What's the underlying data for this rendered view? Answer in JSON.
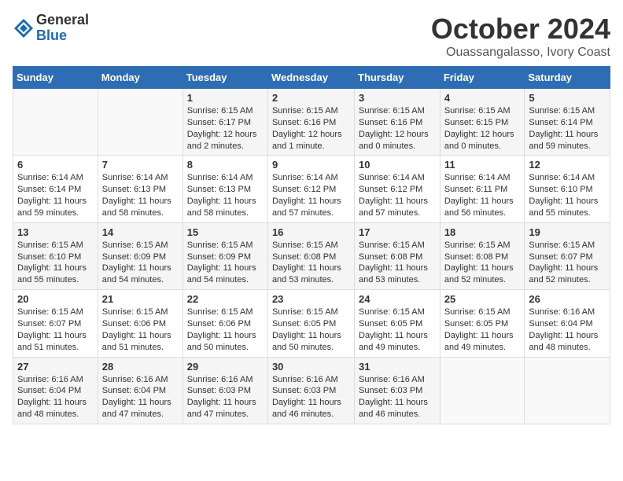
{
  "header": {
    "logo_general": "General",
    "logo_blue": "Blue",
    "month_title": "October 2024",
    "location": "Ouassangalasso, Ivory Coast"
  },
  "weekdays": [
    "Sunday",
    "Monday",
    "Tuesday",
    "Wednesday",
    "Thursday",
    "Friday",
    "Saturday"
  ],
  "weeks": [
    [
      {
        "day": "",
        "text": ""
      },
      {
        "day": "",
        "text": ""
      },
      {
        "day": "1",
        "text": "Sunrise: 6:15 AM\nSunset: 6:17 PM\nDaylight: 12 hours\nand 2 minutes."
      },
      {
        "day": "2",
        "text": "Sunrise: 6:15 AM\nSunset: 6:16 PM\nDaylight: 12 hours\nand 1 minute."
      },
      {
        "day": "3",
        "text": "Sunrise: 6:15 AM\nSunset: 6:16 PM\nDaylight: 12 hours\nand 0 minutes."
      },
      {
        "day": "4",
        "text": "Sunrise: 6:15 AM\nSunset: 6:15 PM\nDaylight: 12 hours\nand 0 minutes."
      },
      {
        "day": "5",
        "text": "Sunrise: 6:15 AM\nSunset: 6:14 PM\nDaylight: 11 hours\nand 59 minutes."
      }
    ],
    [
      {
        "day": "6",
        "text": "Sunrise: 6:14 AM\nSunset: 6:14 PM\nDaylight: 11 hours\nand 59 minutes."
      },
      {
        "day": "7",
        "text": "Sunrise: 6:14 AM\nSunset: 6:13 PM\nDaylight: 11 hours\nand 58 minutes."
      },
      {
        "day": "8",
        "text": "Sunrise: 6:14 AM\nSunset: 6:13 PM\nDaylight: 11 hours\nand 58 minutes."
      },
      {
        "day": "9",
        "text": "Sunrise: 6:14 AM\nSunset: 6:12 PM\nDaylight: 11 hours\nand 57 minutes."
      },
      {
        "day": "10",
        "text": "Sunrise: 6:14 AM\nSunset: 6:12 PM\nDaylight: 11 hours\nand 57 minutes."
      },
      {
        "day": "11",
        "text": "Sunrise: 6:14 AM\nSunset: 6:11 PM\nDaylight: 11 hours\nand 56 minutes."
      },
      {
        "day": "12",
        "text": "Sunrise: 6:14 AM\nSunset: 6:10 PM\nDaylight: 11 hours\nand 55 minutes."
      }
    ],
    [
      {
        "day": "13",
        "text": "Sunrise: 6:15 AM\nSunset: 6:10 PM\nDaylight: 11 hours\nand 55 minutes."
      },
      {
        "day": "14",
        "text": "Sunrise: 6:15 AM\nSunset: 6:09 PM\nDaylight: 11 hours\nand 54 minutes."
      },
      {
        "day": "15",
        "text": "Sunrise: 6:15 AM\nSunset: 6:09 PM\nDaylight: 11 hours\nand 54 minutes."
      },
      {
        "day": "16",
        "text": "Sunrise: 6:15 AM\nSunset: 6:08 PM\nDaylight: 11 hours\nand 53 minutes."
      },
      {
        "day": "17",
        "text": "Sunrise: 6:15 AM\nSunset: 6:08 PM\nDaylight: 11 hours\nand 53 minutes."
      },
      {
        "day": "18",
        "text": "Sunrise: 6:15 AM\nSunset: 6:08 PM\nDaylight: 11 hours\nand 52 minutes."
      },
      {
        "day": "19",
        "text": "Sunrise: 6:15 AM\nSunset: 6:07 PM\nDaylight: 11 hours\nand 52 minutes."
      }
    ],
    [
      {
        "day": "20",
        "text": "Sunrise: 6:15 AM\nSunset: 6:07 PM\nDaylight: 11 hours\nand 51 minutes."
      },
      {
        "day": "21",
        "text": "Sunrise: 6:15 AM\nSunset: 6:06 PM\nDaylight: 11 hours\nand 51 minutes."
      },
      {
        "day": "22",
        "text": "Sunrise: 6:15 AM\nSunset: 6:06 PM\nDaylight: 11 hours\nand 50 minutes."
      },
      {
        "day": "23",
        "text": "Sunrise: 6:15 AM\nSunset: 6:05 PM\nDaylight: 11 hours\nand 50 minutes."
      },
      {
        "day": "24",
        "text": "Sunrise: 6:15 AM\nSunset: 6:05 PM\nDaylight: 11 hours\nand 49 minutes."
      },
      {
        "day": "25",
        "text": "Sunrise: 6:15 AM\nSunset: 6:05 PM\nDaylight: 11 hours\nand 49 minutes."
      },
      {
        "day": "26",
        "text": "Sunrise: 6:16 AM\nSunset: 6:04 PM\nDaylight: 11 hours\nand 48 minutes."
      }
    ],
    [
      {
        "day": "27",
        "text": "Sunrise: 6:16 AM\nSunset: 6:04 PM\nDaylight: 11 hours\nand 48 minutes."
      },
      {
        "day": "28",
        "text": "Sunrise: 6:16 AM\nSunset: 6:04 PM\nDaylight: 11 hours\nand 47 minutes."
      },
      {
        "day": "29",
        "text": "Sunrise: 6:16 AM\nSunset: 6:03 PM\nDaylight: 11 hours\nand 47 minutes."
      },
      {
        "day": "30",
        "text": "Sunrise: 6:16 AM\nSunset: 6:03 PM\nDaylight: 11 hours\nand 46 minutes."
      },
      {
        "day": "31",
        "text": "Sunrise: 6:16 AM\nSunset: 6:03 PM\nDaylight: 11 hours\nand 46 minutes."
      },
      {
        "day": "",
        "text": ""
      },
      {
        "day": "",
        "text": ""
      }
    ]
  ]
}
